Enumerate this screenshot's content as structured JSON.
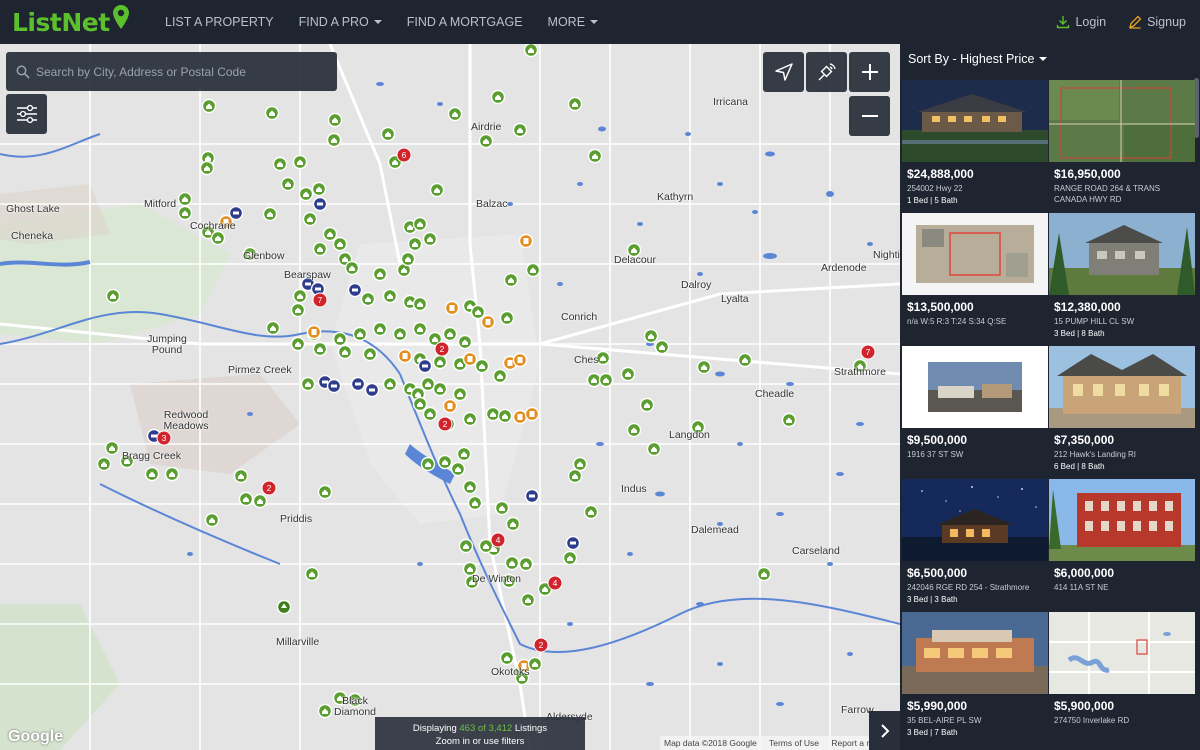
{
  "header": {
    "logo": "ListNet",
    "nav": [
      {
        "label": "LIST A PROPERTY",
        "dropdown": false
      },
      {
        "label": "FIND A PRO",
        "dropdown": true
      },
      {
        "label": "FIND A MORTGAGE",
        "dropdown": false
      },
      {
        "label": "MORE",
        "dropdown": true
      }
    ],
    "login": "Login",
    "signup": "Signup"
  },
  "colors": {
    "brand": "#5cc02c",
    "header_bg": "#1e2430",
    "marker_green": "#5a9e30",
    "marker_orange": "#e38f1f",
    "marker_navy": "#2e3d8c",
    "cluster_red": "#d0232b"
  },
  "search": {
    "placeholder": "Search by City, Address or Postal Code"
  },
  "map": {
    "places": [
      "Irricana",
      "Airdrie",
      "Ghost Lake",
      "Mitford",
      "Cochrane",
      "Balzac",
      "Kathyrn",
      "Cheneka",
      "Glenbow",
      "Bearspaw",
      "Delacour",
      "Ardenode",
      "Nightingale",
      "Dalroy",
      "Lyalta",
      "Conrich",
      "Jumping Pound",
      "Pirmez Creek",
      "Chestermere",
      "Strathmore",
      "Cheadle",
      "Redwood Meadows",
      "Bragg Creek",
      "Langdon",
      "Indus",
      "Priddis",
      "Dalemead",
      "Carseland",
      "De Winton",
      "Millarville",
      "Okotoks",
      "Black Diamond",
      "Aldersyde",
      "Farrow"
    ],
    "cluster_counts": [
      "6",
      "7",
      "2",
      "3",
      "2",
      "2",
      "7",
      "4",
      "4",
      "2"
    ],
    "status_prefix": "Displaying",
    "status_count": "463 of 3,412",
    "status_suffix": "Listings",
    "status_line2": "Zoom in or use filters",
    "attribution": [
      "Map data ©2018 Google",
      "Terms of Use",
      "Report a map error"
    ],
    "google": "Google"
  },
  "sidebar": {
    "sort_label": "Sort By - Highest Price",
    "listings": [
      {
        "price": "$24,888,000",
        "address": "254002 Hwy 22",
        "beds": "1 Bed | 5 Bath",
        "thumb": "night-estate"
      },
      {
        "price": "$16,950,000",
        "address": "RANGE ROAD 264 & TRANS CANADA HWY RD",
        "beds": "",
        "thumb": "aerial-field"
      },
      {
        "price": "$13,500,000",
        "address": "n/a W:5 R:3 T:24 S:34 Q:SE",
        "beds": "",
        "thumb": "site-plan"
      },
      {
        "price": "$12,380,000",
        "address": "15 PUMP HILL CL SW",
        "beds": "3 Bed | 8 Bath",
        "thumb": "forest-house"
      },
      {
        "price": "$9,500,000",
        "address": "1916 37 ST SW",
        "beds": "",
        "thumb": "building-photo"
      },
      {
        "price": "$7,350,000",
        "address": "212 Hawk's Landing RI",
        "beds": "6 Bed | 8 Bath",
        "thumb": "timber-mansion"
      },
      {
        "price": "$6,500,000",
        "address": "242046 RGE RD 254 - Strathmore",
        "beds": "3 Bed | 3 Bath",
        "thumb": "starry-night"
      },
      {
        "price": "$6,000,000",
        "address": "414 11A ST NE",
        "beds": "",
        "thumb": "red-building"
      },
      {
        "price": "$5,990,000",
        "address": "35 BEL-AIRE PL SW",
        "beds": "3 Bed | 7 Bath",
        "thumb": "modern-house"
      },
      {
        "price": "$5,900,000",
        "address": "274750 Inverlake RD",
        "beds": "",
        "thumb": "map-thumb"
      }
    ]
  }
}
